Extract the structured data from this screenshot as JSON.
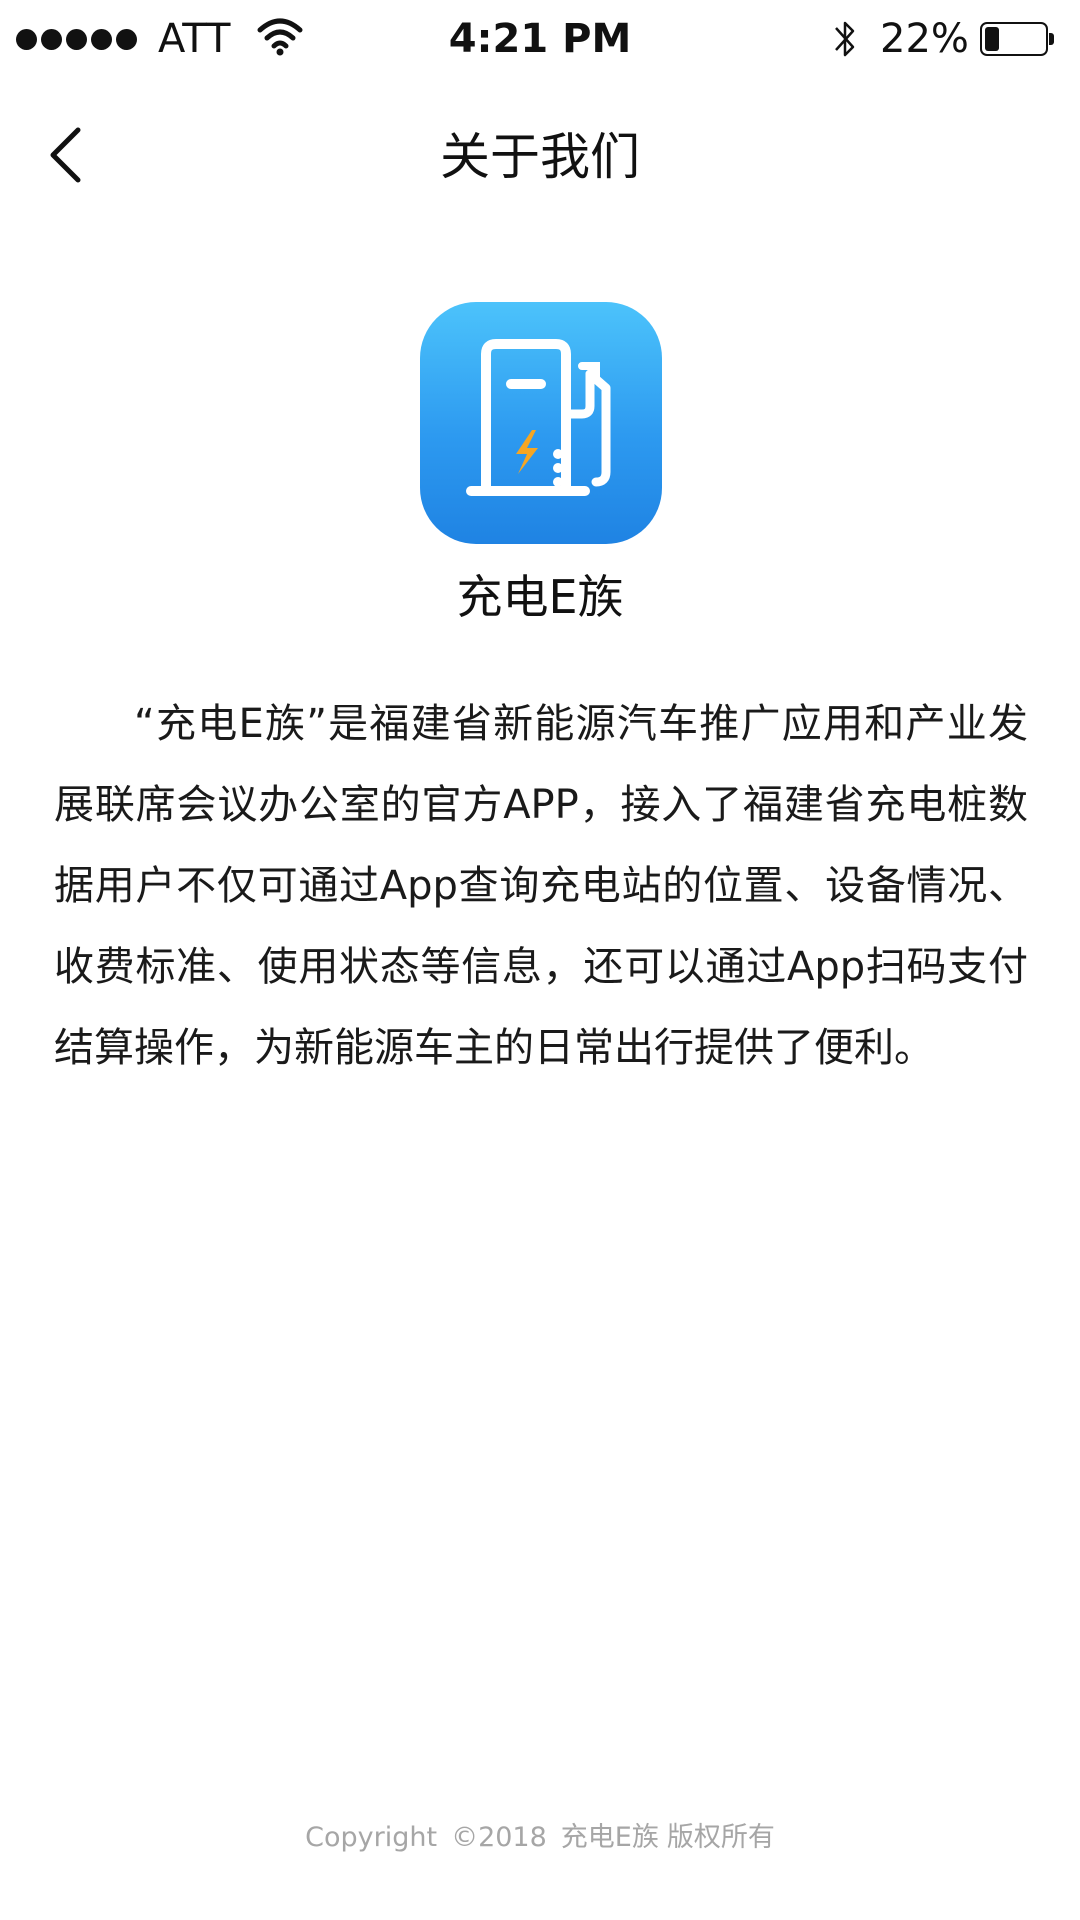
{
  "status_bar": {
    "carrier": "ATT",
    "time": "4:21 PM",
    "battery_percent": "22%",
    "battery_level": 0.22,
    "signal_bars": 5
  },
  "nav": {
    "back_icon": "chevron-left-icon",
    "title": "关于我们"
  },
  "app": {
    "icon": "charging-station-icon",
    "name": "充电E族",
    "icon_colors": {
      "gradient_top": "#4cc3fb",
      "gradient_bottom": "#1f83e3",
      "bolt": "#f5a623"
    }
  },
  "about": {
    "description": "“充电E族”是福建省新能源汽车推广应用和产业发展联席会议办公室的官方APP，接入了福建省充电桩数据用户不仅可通过App查询充电站的位置、设备情况、收费标准、使用状态等信息，还可以通过App扫码支付结算操作，为新能源车主的日常出行提供了便利。"
  },
  "footer": {
    "copyright_label": "Copyright",
    "year": "©2018",
    "brand": "充电E族",
    "rights": "版权所有"
  }
}
